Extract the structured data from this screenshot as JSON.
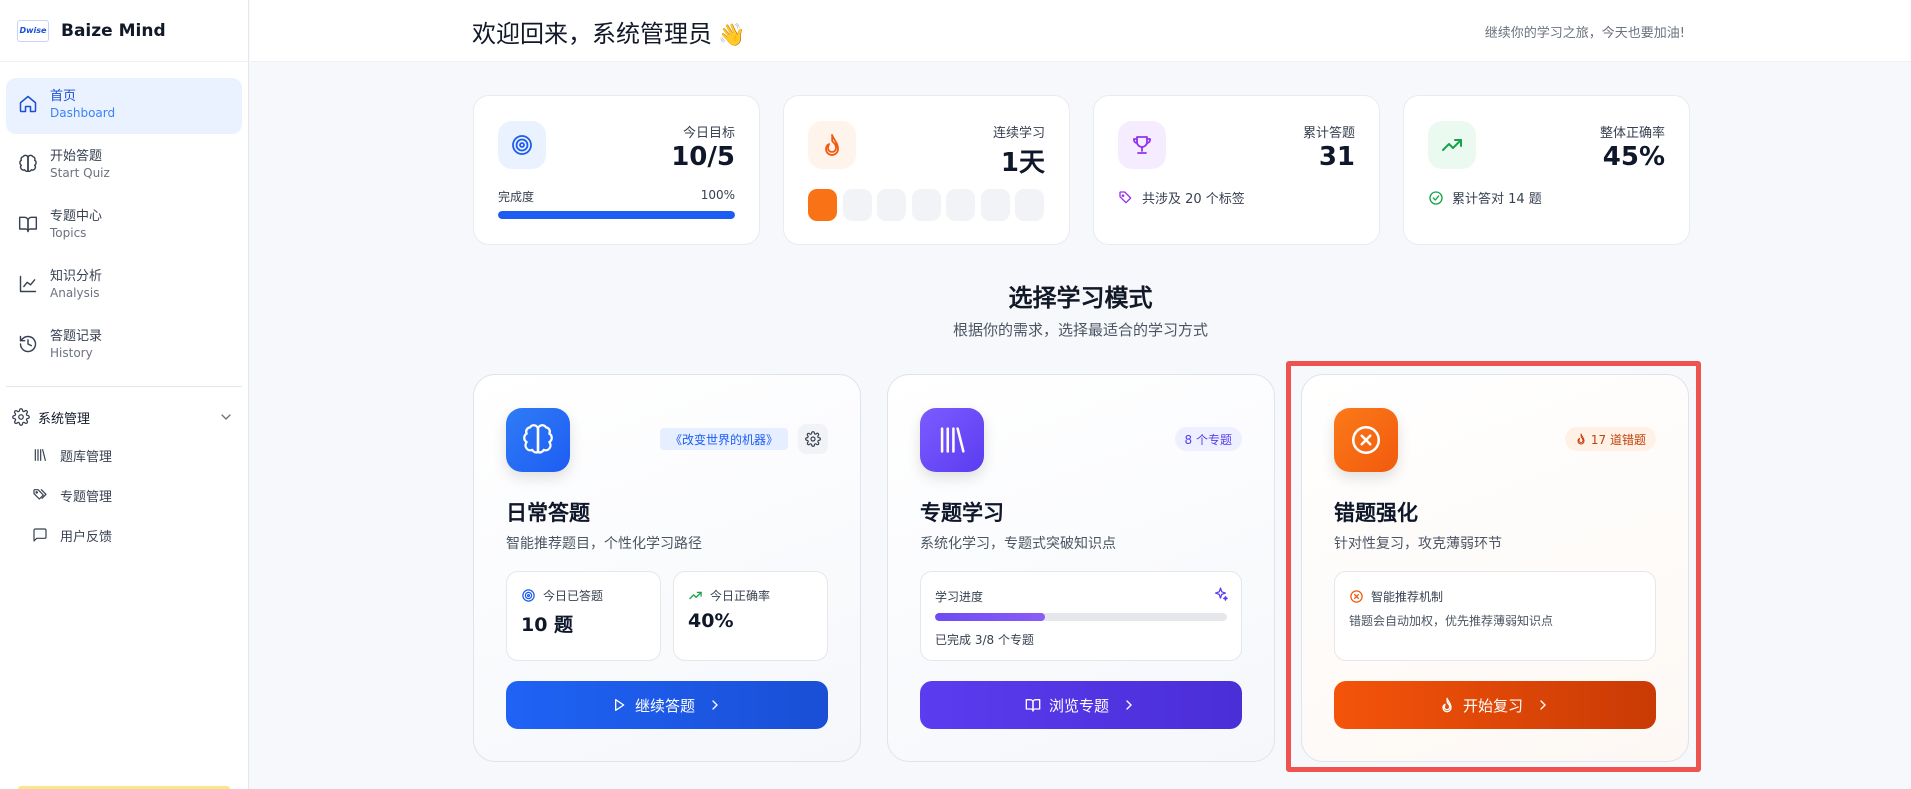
{
  "brand": {
    "logo_text": "Dwise",
    "name": "Baize Mind"
  },
  "nav": [
    {
      "zh": "首页",
      "en": "Dashboard",
      "icon": "home-icon",
      "active": true
    },
    {
      "zh": "开始答题",
      "en": "Start Quiz",
      "icon": "brain-icon"
    },
    {
      "zh": "专题中心",
      "en": "Topics",
      "icon": "book-open-icon"
    },
    {
      "zh": "知识分析",
      "en": "Analysis",
      "icon": "line-chart-icon"
    },
    {
      "zh": "答题记录",
      "en": "History",
      "icon": "history-icon"
    }
  ],
  "admin": {
    "label": "系统管理",
    "items": [
      {
        "label": "题库管理",
        "icon": "library-icon"
      },
      {
        "label": "专题管理",
        "icon": "tags-icon"
      },
      {
        "label": "用户反馈",
        "icon": "message-square-icon"
      }
    ]
  },
  "header": {
    "welcome": "欢迎回来，系统管理员",
    "wave": "👋",
    "tagline": "继续你的学习之旅，今天也要加油!"
  },
  "stats": {
    "goal": {
      "label": "今日目标",
      "value": "10/5",
      "progress_label": "完成度",
      "progress_text": "100%",
      "progress": 1.0
    },
    "streak": {
      "label": "连续学习",
      "value": "1天",
      "days_total": 7,
      "days_done": 1
    },
    "total": {
      "label": "累计答题",
      "value": "31",
      "footnote": "共涉及 20 个标签"
    },
    "accuracy": {
      "label": "整体正确率",
      "value": "45%",
      "footnote": "累计答对 14 题"
    }
  },
  "section": {
    "title": "选择学习模式",
    "subtitle": "根据你的需求，选择最适合的学习方式"
  },
  "modes": {
    "daily": {
      "title": "日常答题",
      "desc": "智能推荐题目，个性化学习路径",
      "badge": "《改变世界的机器》",
      "stat1_label": "今日已答题",
      "stat1_value": "10 题",
      "stat2_label": "今日正确率",
      "stat2_value": "40%",
      "button": "继续答题"
    },
    "topic": {
      "title": "专题学习",
      "desc": "系统化学习，专题式突破知识点",
      "badge": "8 个专题",
      "progress_label": "学习进度",
      "progress": 0.375,
      "progress_text": "已完成 3/8 个专题",
      "button": "浏览专题"
    },
    "review": {
      "title": "错题强化",
      "desc": "针对性复习，攻克薄弱环节",
      "badge": "17 道错题",
      "info_title": "智能推荐机制",
      "info_text": "错题会自动加权，优先推荐薄弱知识点",
      "button": "开始复习"
    }
  },
  "colors": {
    "primary": "#1d5cf2",
    "purple": "#5b3cf0",
    "orange": "#f15a0e",
    "highlight": "#ef5350"
  }
}
